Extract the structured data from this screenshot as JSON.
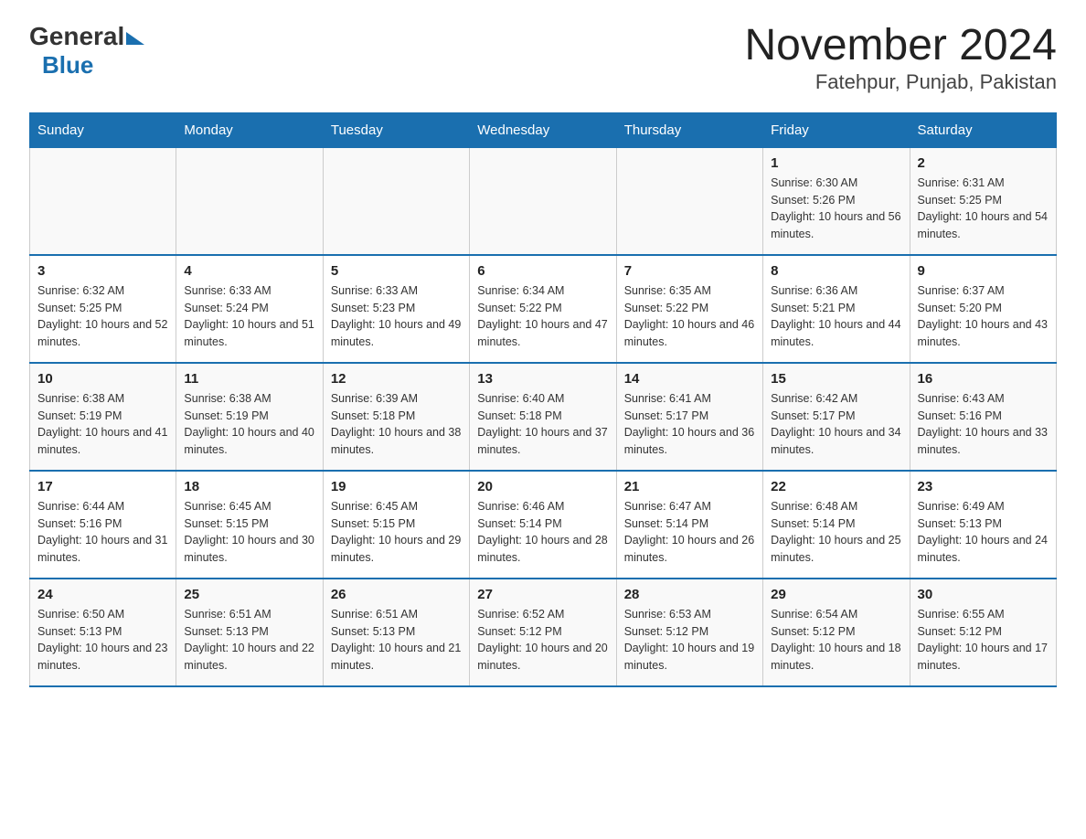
{
  "header": {
    "logo": {
      "general": "General",
      "blue": "Blue"
    },
    "title": "November 2024",
    "subtitle": "Fatehpur, Punjab, Pakistan"
  },
  "days_of_week": [
    "Sunday",
    "Monday",
    "Tuesday",
    "Wednesday",
    "Thursday",
    "Friday",
    "Saturday"
  ],
  "weeks": [
    [
      {
        "day": "",
        "info": ""
      },
      {
        "day": "",
        "info": ""
      },
      {
        "day": "",
        "info": ""
      },
      {
        "day": "",
        "info": ""
      },
      {
        "day": "",
        "info": ""
      },
      {
        "day": "1",
        "info": "Sunrise: 6:30 AM\nSunset: 5:26 PM\nDaylight: 10 hours and 56 minutes."
      },
      {
        "day": "2",
        "info": "Sunrise: 6:31 AM\nSunset: 5:25 PM\nDaylight: 10 hours and 54 minutes."
      }
    ],
    [
      {
        "day": "3",
        "info": "Sunrise: 6:32 AM\nSunset: 5:25 PM\nDaylight: 10 hours and 52 minutes."
      },
      {
        "day": "4",
        "info": "Sunrise: 6:33 AM\nSunset: 5:24 PM\nDaylight: 10 hours and 51 minutes."
      },
      {
        "day": "5",
        "info": "Sunrise: 6:33 AM\nSunset: 5:23 PM\nDaylight: 10 hours and 49 minutes."
      },
      {
        "day": "6",
        "info": "Sunrise: 6:34 AM\nSunset: 5:22 PM\nDaylight: 10 hours and 47 minutes."
      },
      {
        "day": "7",
        "info": "Sunrise: 6:35 AM\nSunset: 5:22 PM\nDaylight: 10 hours and 46 minutes."
      },
      {
        "day": "8",
        "info": "Sunrise: 6:36 AM\nSunset: 5:21 PM\nDaylight: 10 hours and 44 minutes."
      },
      {
        "day": "9",
        "info": "Sunrise: 6:37 AM\nSunset: 5:20 PM\nDaylight: 10 hours and 43 minutes."
      }
    ],
    [
      {
        "day": "10",
        "info": "Sunrise: 6:38 AM\nSunset: 5:19 PM\nDaylight: 10 hours and 41 minutes."
      },
      {
        "day": "11",
        "info": "Sunrise: 6:38 AM\nSunset: 5:19 PM\nDaylight: 10 hours and 40 minutes."
      },
      {
        "day": "12",
        "info": "Sunrise: 6:39 AM\nSunset: 5:18 PM\nDaylight: 10 hours and 38 minutes."
      },
      {
        "day": "13",
        "info": "Sunrise: 6:40 AM\nSunset: 5:18 PM\nDaylight: 10 hours and 37 minutes."
      },
      {
        "day": "14",
        "info": "Sunrise: 6:41 AM\nSunset: 5:17 PM\nDaylight: 10 hours and 36 minutes."
      },
      {
        "day": "15",
        "info": "Sunrise: 6:42 AM\nSunset: 5:17 PM\nDaylight: 10 hours and 34 minutes."
      },
      {
        "day": "16",
        "info": "Sunrise: 6:43 AM\nSunset: 5:16 PM\nDaylight: 10 hours and 33 minutes."
      }
    ],
    [
      {
        "day": "17",
        "info": "Sunrise: 6:44 AM\nSunset: 5:16 PM\nDaylight: 10 hours and 31 minutes."
      },
      {
        "day": "18",
        "info": "Sunrise: 6:45 AM\nSunset: 5:15 PM\nDaylight: 10 hours and 30 minutes."
      },
      {
        "day": "19",
        "info": "Sunrise: 6:45 AM\nSunset: 5:15 PM\nDaylight: 10 hours and 29 minutes."
      },
      {
        "day": "20",
        "info": "Sunrise: 6:46 AM\nSunset: 5:14 PM\nDaylight: 10 hours and 28 minutes."
      },
      {
        "day": "21",
        "info": "Sunrise: 6:47 AM\nSunset: 5:14 PM\nDaylight: 10 hours and 26 minutes."
      },
      {
        "day": "22",
        "info": "Sunrise: 6:48 AM\nSunset: 5:14 PM\nDaylight: 10 hours and 25 minutes."
      },
      {
        "day": "23",
        "info": "Sunrise: 6:49 AM\nSunset: 5:13 PM\nDaylight: 10 hours and 24 minutes."
      }
    ],
    [
      {
        "day": "24",
        "info": "Sunrise: 6:50 AM\nSunset: 5:13 PM\nDaylight: 10 hours and 23 minutes."
      },
      {
        "day": "25",
        "info": "Sunrise: 6:51 AM\nSunset: 5:13 PM\nDaylight: 10 hours and 22 minutes."
      },
      {
        "day": "26",
        "info": "Sunrise: 6:51 AM\nSunset: 5:13 PM\nDaylight: 10 hours and 21 minutes."
      },
      {
        "day": "27",
        "info": "Sunrise: 6:52 AM\nSunset: 5:12 PM\nDaylight: 10 hours and 20 minutes."
      },
      {
        "day": "28",
        "info": "Sunrise: 6:53 AM\nSunset: 5:12 PM\nDaylight: 10 hours and 19 minutes."
      },
      {
        "day": "29",
        "info": "Sunrise: 6:54 AM\nSunset: 5:12 PM\nDaylight: 10 hours and 18 minutes."
      },
      {
        "day": "30",
        "info": "Sunrise: 6:55 AM\nSunset: 5:12 PM\nDaylight: 10 hours and 17 minutes."
      }
    ]
  ]
}
